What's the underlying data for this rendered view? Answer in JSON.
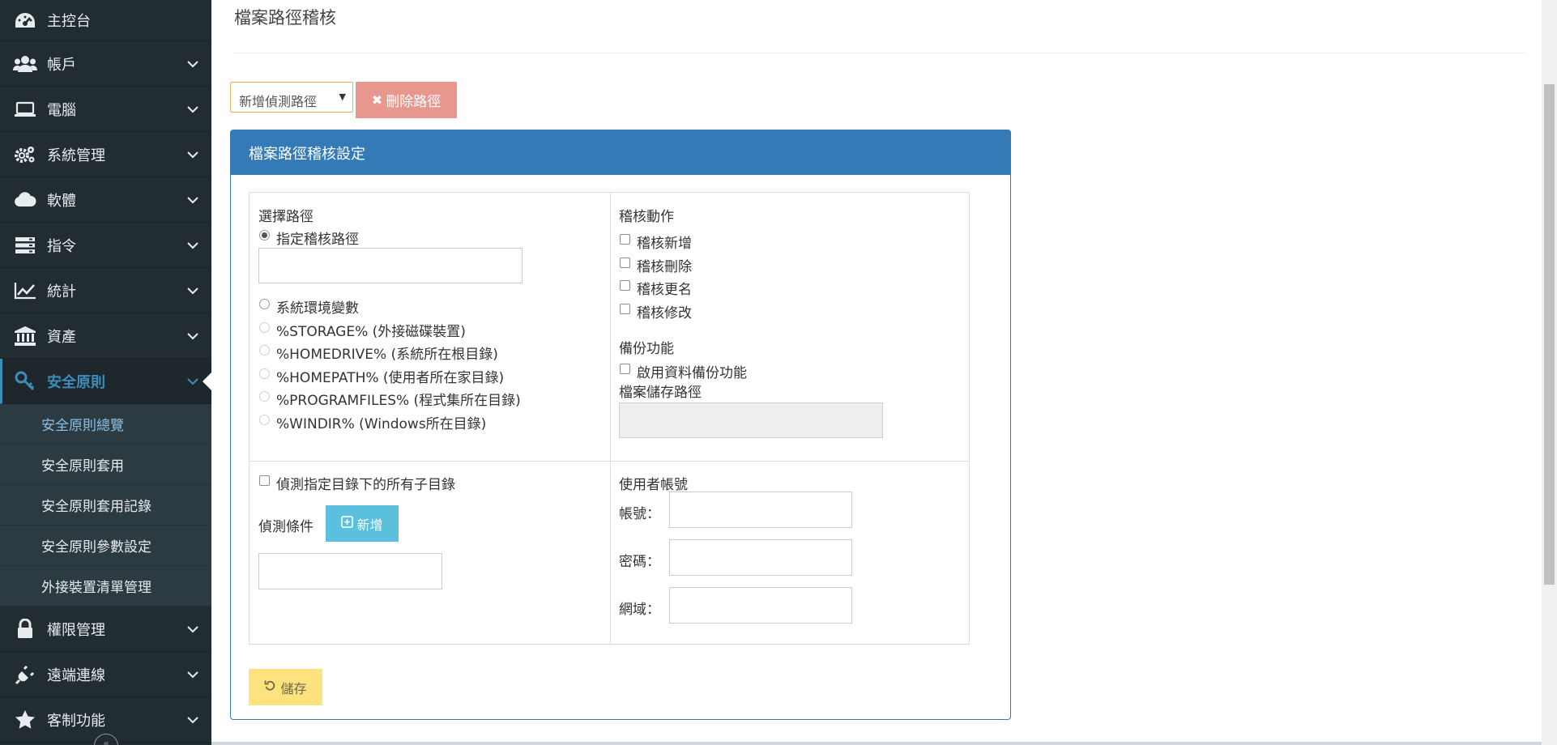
{
  "sidebar": {
    "items": [
      {
        "label": "主控台",
        "icon": "dashboard-icon"
      },
      {
        "label": "帳戶",
        "icon": "users-icon"
      },
      {
        "label": "電腦",
        "icon": "laptop-icon"
      },
      {
        "label": "系統管理",
        "icon": "gears-icon"
      },
      {
        "label": "軟體",
        "icon": "cloud-icon"
      },
      {
        "label": "指令",
        "icon": "server-icon"
      },
      {
        "label": "統計",
        "icon": "line-chart-icon"
      },
      {
        "label": "資產",
        "icon": "bank-icon"
      },
      {
        "label": "安全原則",
        "icon": "key-icon"
      },
      {
        "label": "權限管理",
        "icon": "lock-icon"
      },
      {
        "label": "遠端連線",
        "icon": "plug-icon"
      },
      {
        "label": "客制功能",
        "icon": "star-icon"
      }
    ],
    "submenu": [
      {
        "label": "安全原則總覽"
      },
      {
        "label": "安全原則套用"
      },
      {
        "label": "安全原則套用記錄"
      },
      {
        "label": "安全原則參數設定"
      },
      {
        "label": "外接裝置清單管理"
      }
    ],
    "collapse": "«"
  },
  "page": {
    "title": "檔案路徑稽核"
  },
  "toolbar": {
    "select_value": "新增偵測路徑",
    "delete_label": "刪除路徑"
  },
  "panel": {
    "title": "檔案路徑稽核設定",
    "path_section": {
      "label": "選擇路徑",
      "specify_option": "指定稽核路徑",
      "sysenv_option": "系統環境變數",
      "env_options": [
        "%STORAGE% (外接磁碟裝置)",
        "%HOMEDRIVE% (系統所在根目錄)",
        "%HOMEPATH% (使用者所在家目錄)",
        "%PROGRAMFILES% (程式集所在目錄)",
        "%WINDIR% (Windows所在目錄)"
      ]
    },
    "audit_section": {
      "label": "稽核動作",
      "options": [
        "稽核新增",
        "稽核刪除",
        "稽核更名",
        "稽核修改"
      ]
    },
    "backup_section": {
      "label": "備份功能",
      "enable_option": "啟用資料備份功能",
      "storage_label": "檔案儲存路徑"
    },
    "detect_section": {
      "subdir_option": "偵測指定目錄下的所有子目錄",
      "condition_label": "偵測條件",
      "add_label": "新增"
    },
    "account_section": {
      "label": "使用者帳號",
      "account_label": "帳號：",
      "password_label": "密碼：",
      "domain_label": "網域："
    },
    "save_label": "儲存"
  },
  "colors": {
    "sidebar_bg": "#222d32",
    "accent": "#3c8dbc",
    "panel_head": "#337ab7",
    "delete_btn": "#e8978f",
    "add_btn": "#5bc0de",
    "save_btn": "#fde27d"
  }
}
